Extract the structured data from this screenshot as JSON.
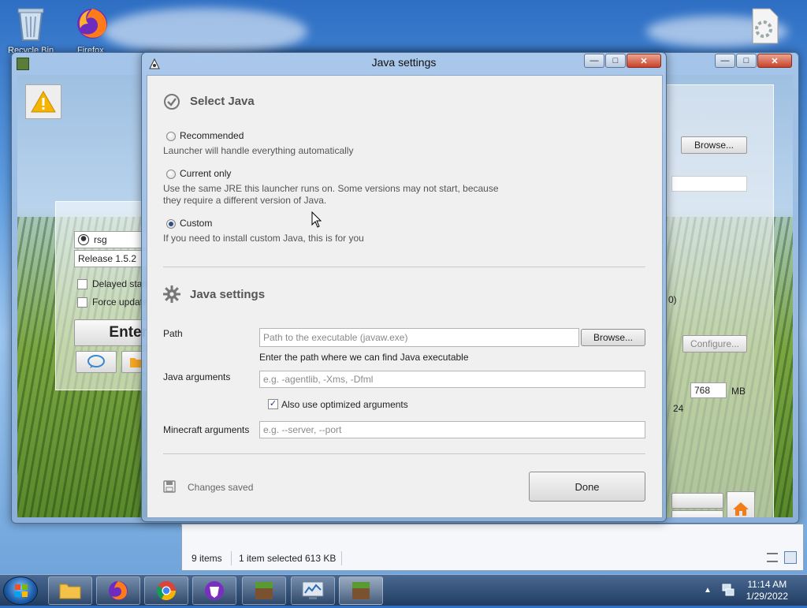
{
  "desktop": {
    "recycle_bin_label": "Recycle Bin",
    "firefox_label": "Firefox"
  },
  "launcher": {
    "username": "rsg",
    "version": "Release 1.5.2",
    "delayed_start": "Delayed start",
    "force_update": "Force update",
    "enter_label": "Enter",
    "browse_label": "Browse...",
    "configure_label": "Configure...",
    "memory_value": "768",
    "memory_unit": "MB",
    "partial_text_1": "0)",
    "partial_text_2": "24"
  },
  "dialog": {
    "title": "Java settings",
    "select_java_heading": "Select Java",
    "options": [
      {
        "label": "Recommended",
        "desc": "Launcher will handle everything automatically",
        "selected": false
      },
      {
        "label": "Current only",
        "desc": "Use the same JRE this launcher runs on. Some versions may not start, because they require a different version of Java.",
        "selected": false
      },
      {
        "label": "Custom",
        "desc": "If you need to install custom Java, this is for you",
        "selected": true
      }
    ],
    "java_settings_heading": "Java settings",
    "path_label": "Path",
    "path_placeholder": "Path to the executable (javaw.exe)",
    "path_browse": "Browse...",
    "path_hint": "Enter the path where we can find Java executable",
    "java_args_label": "Java arguments",
    "java_args_placeholder": "e.g. -agentlib, -Xms, -Dfml",
    "optimized_label": "Also use optimized arguments",
    "optimized_checked": true,
    "mc_args_label": "Minecraft arguments",
    "mc_args_placeholder": "e.g. --server, --port",
    "status": "Changes saved",
    "done": "Done"
  },
  "explorer_status": {
    "items": "9 items",
    "selected": "1 item selected",
    "size": "613 KB"
  },
  "taskbar": {
    "time": "11:14 AM",
    "date": "1/29/2022"
  },
  "colors": {
    "accent_orange": "#f07d1a",
    "warning_yellow": "#f5b400",
    "dialog_bg": "#f0f0f0",
    "radio_dot": "#2f4f86"
  }
}
